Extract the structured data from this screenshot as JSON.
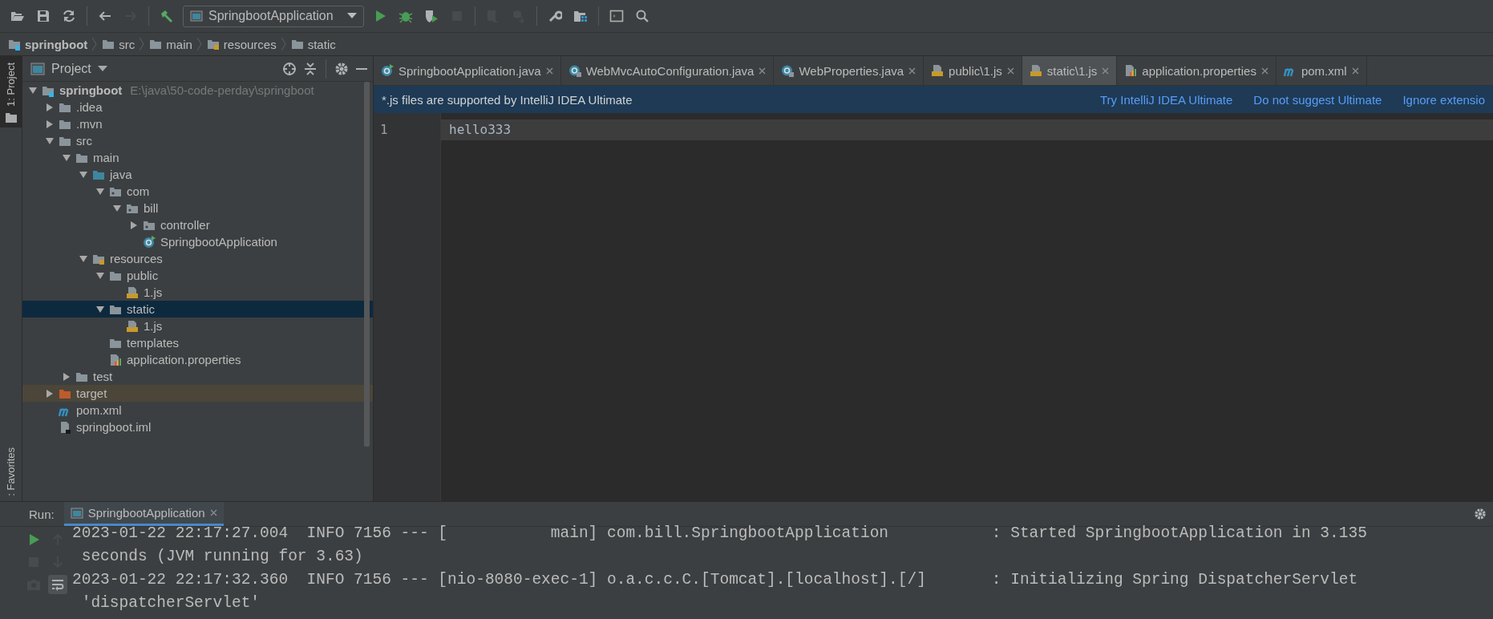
{
  "toolbar": [
    {
      "kind": "open",
      "disabled": false
    },
    {
      "kind": "save",
      "disabled": false
    },
    {
      "kind": "sync",
      "disabled": false
    },
    {
      "kind": "separator"
    },
    {
      "kind": "back",
      "disabled": false
    },
    {
      "kind": "forward",
      "disabled": true
    },
    {
      "kind": "separator"
    },
    {
      "kind": "build",
      "disabled": false
    },
    {
      "kind": "config"
    },
    {
      "kind": "run",
      "disabled": false
    },
    {
      "kind": "debug",
      "disabled": false
    },
    {
      "kind": "coverage",
      "disabled": false
    },
    {
      "kind": "stop",
      "disabled": true
    },
    {
      "kind": "separator"
    },
    {
      "kind": "attach",
      "disabled": true
    },
    {
      "kind": "deploy",
      "disabled": true
    },
    {
      "kind": "separator"
    },
    {
      "kind": "wrench",
      "disabled": false
    },
    {
      "kind": "structure",
      "disabled": false
    },
    {
      "kind": "separator"
    },
    {
      "kind": "terminal",
      "disabled": false
    },
    {
      "kind": "search",
      "disabled": false
    }
  ],
  "run_configuration": {
    "label": "SpringbootApplication"
  },
  "breadcrumb": [
    {
      "label": "springboot",
      "kind": "module"
    },
    {
      "label": "src",
      "kind": "folder"
    },
    {
      "label": "main",
      "kind": "folder"
    },
    {
      "label": "resources",
      "kind": "resources"
    },
    {
      "label": "static",
      "kind": "folder"
    }
  ],
  "left_stripe": {
    "tabs": [
      {
        "label": "1: Project",
        "selected": true
      }
    ],
    "favorites": ": Favorites"
  },
  "project_panel": {
    "title": "Project",
    "tree": [
      {
        "label": "springboot",
        "detail": "E:\\java\\50-code-perday\\springboot",
        "kind": "module",
        "expanded": true,
        "selected": false,
        "children": [
          {
            "label": ".idea",
            "kind": "folder",
            "expanded": false,
            "selected": false
          },
          {
            "label": ".mvn",
            "kind": "folder",
            "expanded": false,
            "selected": false
          },
          {
            "label": "src",
            "kind": "folder",
            "expanded": true,
            "selected": false,
            "children": [
              {
                "label": "main",
                "kind": "folder",
                "expanded": true,
                "selected": false,
                "children": [
                  {
                    "label": "java",
                    "kind": "source",
                    "expanded": true,
                    "selected": false,
                    "children": [
                      {
                        "label": "com",
                        "kind": "package",
                        "expanded": true,
                        "selected": false,
                        "children": [
                          {
                            "label": "bill",
                            "kind": "package",
                            "expanded": true,
                            "selected": false,
                            "children": [
                              {
                                "label": "controller",
                                "kind": "package",
                                "expanded": false,
                                "selected": false
                              },
                              {
                                "label": "SpringbootApplication",
                                "kind": "class",
                                "selected": false
                              }
                            ]
                          }
                        ]
                      }
                    ]
                  },
                  {
                    "label": "resources",
                    "kind": "resources",
                    "expanded": true,
                    "selected": false,
                    "children": [
                      {
                        "label": "public",
                        "kind": "folder",
                        "expanded": true,
                        "selected": false,
                        "children": [
                          {
                            "label": "1.js",
                            "kind": "js",
                            "selected": false
                          }
                        ]
                      },
                      {
                        "label": "static",
                        "kind": "folder",
                        "expanded": true,
                        "selected": true,
                        "children": [
                          {
                            "label": "1.js",
                            "kind": "js",
                            "selected": false
                          }
                        ]
                      },
                      {
                        "label": "templates",
                        "kind": "folder",
                        "selected": false
                      },
                      {
                        "label": "application.properties",
                        "kind": "properties",
                        "selected": false
                      }
                    ]
                  }
                ]
              },
              {
                "label": "test",
                "kind": "folder",
                "expanded": false,
                "selected": false
              }
            ]
          },
          {
            "label": "target",
            "kind": "excluded",
            "expanded": false,
            "selected": false
          },
          {
            "label": "pom.xml",
            "kind": "maven",
            "selected": false
          },
          {
            "label": "springboot.iml",
            "kind": "iml",
            "selected": false
          }
        ]
      }
    ]
  },
  "editor": {
    "tabs": [
      {
        "label": "SpringbootApplication.java",
        "kind": "class",
        "selected": false
      },
      {
        "label": "WebMvcAutoConfiguration.java",
        "kind": "lib-class",
        "selected": false
      },
      {
        "label": "WebProperties.java",
        "kind": "lib-class",
        "selected": false
      },
      {
        "label": "public\\1.js",
        "kind": "js",
        "selected": false
      },
      {
        "label": "static\\1.js",
        "kind": "js",
        "selected": true
      },
      {
        "label": "application.properties",
        "kind": "properties",
        "selected": false
      },
      {
        "label": "pom.xml",
        "kind": "maven",
        "selected": false
      }
    ],
    "notification": {
      "text": "*.js files are supported by IntelliJ IDEA Ultimate",
      "links": [
        "Try IntelliJ IDEA Ultimate",
        "Do not suggest Ultimate",
        "Ignore extensio"
      ]
    },
    "lines": [
      {
        "number": "1",
        "text": "hello333",
        "current": true
      }
    ]
  },
  "run_panel": {
    "label": "Run:",
    "tabs": [
      {
        "label": "SpringbootApplication",
        "selected": true
      }
    ],
    "tools": [
      {
        "kind": "rerun",
        "disabled": false
      },
      {
        "kind": "up",
        "disabled": true
      },
      {
        "kind": "stop",
        "disabled": true
      },
      {
        "kind": "down",
        "disabled": true
      },
      {
        "kind": "camera",
        "disabled": true
      },
      {
        "kind": "wrap",
        "disabled": false
      }
    ],
    "log": [
      "2023-01-22 22:17:27.004  INFO 7156 --- [           main] com.bill.SpringbootApplication           : Started SpringbootApplication in 3.135",
      " seconds (JVM running for 3.63)",
      "2023-01-22 22:17:32.360  INFO 7156 --- [nio-8080-exec-1] o.a.c.c.C.[Tomcat].[localhost].[/]       : Initializing Spring DispatcherServlet",
      " 'dispatcherServlet'"
    ]
  }
}
